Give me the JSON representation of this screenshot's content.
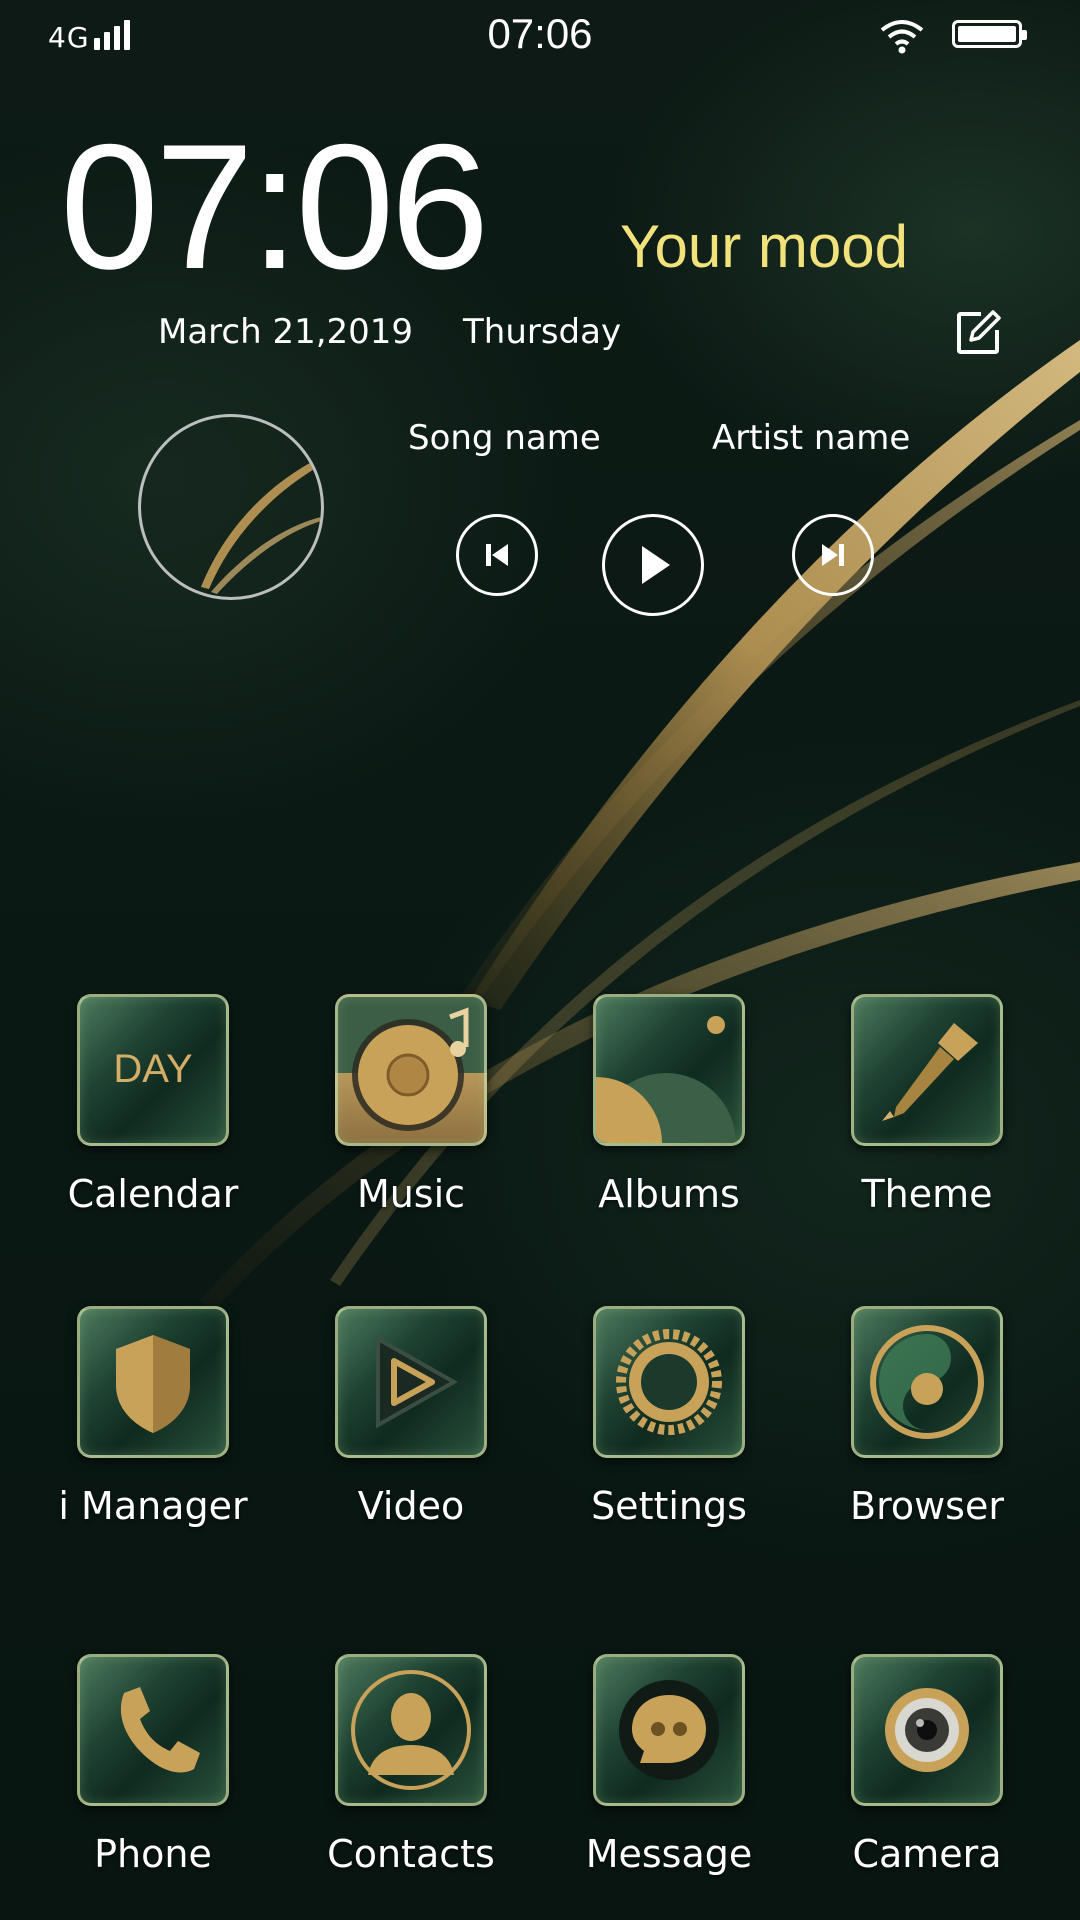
{
  "status_bar": {
    "network": "4G",
    "time": "07:06",
    "icons": [
      "signal-icon",
      "wifi-icon",
      "battery-icon"
    ]
  },
  "clock_widget": {
    "time": "07:06",
    "date": "March 21,2019",
    "weekday": "Thursday",
    "mood": "Your mood",
    "mood_color": "#f1e27c",
    "edit_icon": "edit-icon"
  },
  "music_widget": {
    "song": "Song name",
    "artist": "Artist name",
    "controls": [
      "previous-track-icon",
      "play-icon",
      "next-track-icon"
    ]
  },
  "apps": [
    {
      "label": "Calendar",
      "icon": "calendar-icon",
      "icon_text": "DAY"
    },
    {
      "label": "Music",
      "icon": "music-icon"
    },
    {
      "label": "Albums",
      "icon": "albums-icon"
    },
    {
      "label": "Theme",
      "icon": "paintbrush-icon"
    },
    {
      "label": "i Manager",
      "icon": "shield-icon"
    },
    {
      "label": "Video",
      "icon": "video-play-icon"
    },
    {
      "label": "Settings",
      "icon": "gear-icon"
    },
    {
      "label": "Browser",
      "icon": "browser-icon"
    },
    {
      "label": "Phone",
      "icon": "phone-icon"
    },
    {
      "label": "Contacts",
      "icon": "contact-icon"
    },
    {
      "label": "Message",
      "icon": "message-icon"
    },
    {
      "label": "Camera",
      "icon": "camera-icon"
    }
  ],
  "theme": {
    "accent_gold": "#c9a25a",
    "background": "#0b1914"
  }
}
